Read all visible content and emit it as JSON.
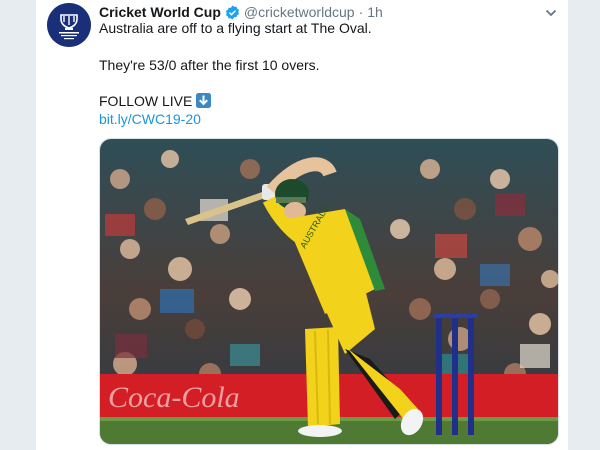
{
  "tweet": {
    "display_name": "Cricket World Cup",
    "handle": "@cricketworldcup",
    "separator": "·",
    "time": "1h",
    "line1": "Australia are off to a flying start at The Oval.",
    "line2": "They're 53/0 after the first 10 overs.",
    "follow_label": "FOLLOW LIVE",
    "link": "bit.ly/CWC19-20"
  },
  "avatar": {
    "logo_text": "ICC CRICKET WORLD CUP ENGLAND & WALES 2019"
  },
  "media": {
    "board_text": "Coca-Cola",
    "shirt_text": "AUSTRALIA",
    "colors": {
      "shirt": "#f2d21b",
      "sky": "#1f3a4a",
      "grass": "#4f7a33",
      "board": "#d41e26"
    }
  },
  "colors": {
    "link": "#1b95e0",
    "verified": "#1da1f2",
    "avatar_bg": "#1a2f7a"
  }
}
